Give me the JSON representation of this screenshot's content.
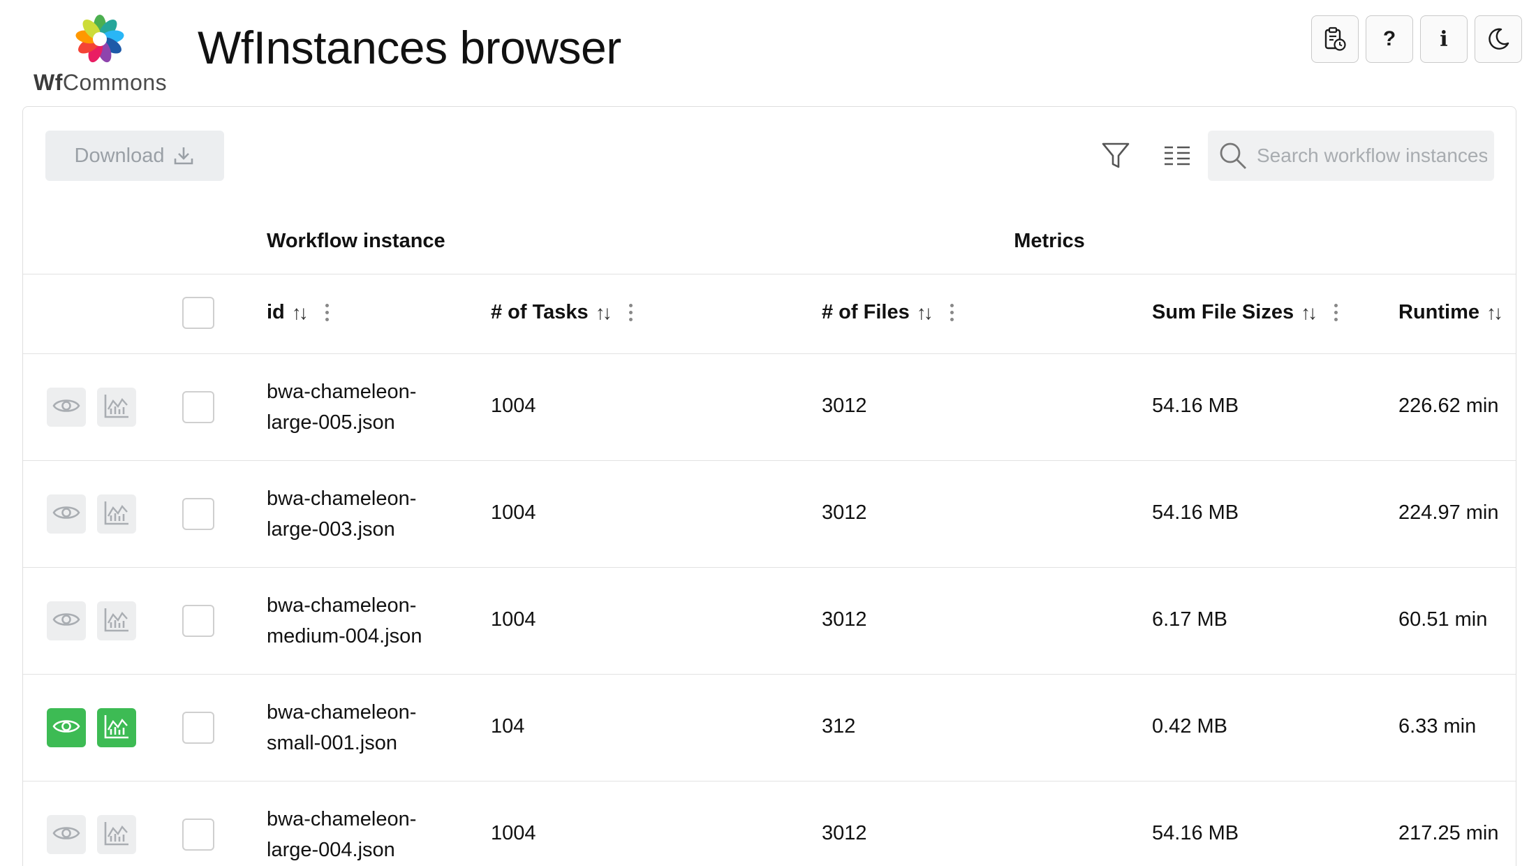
{
  "header": {
    "logo_text_bold": "Wf",
    "logo_text_rest": "Commons",
    "title": "WfInstances browser",
    "buttons": [
      {
        "name": "changelog",
        "icon": "clipboard-clock-icon"
      },
      {
        "name": "help",
        "label": "?"
      },
      {
        "name": "info",
        "label": "i"
      },
      {
        "name": "theme",
        "icon": "moon-icon"
      }
    ]
  },
  "toolbar": {
    "download_label": "Download",
    "search_placeholder": "Search workflow instances"
  },
  "groups": {
    "workflow_instance": "Workflow instance",
    "metrics": "Metrics"
  },
  "columns": {
    "id": "id",
    "tasks": "# of Tasks",
    "files": "# of Files",
    "sum_sizes": "Sum File Sizes",
    "runtime": "Runtime"
  },
  "rows": [
    {
      "id": "bwa-chameleon-large-005.json",
      "id_line1": "bwa-chameleon-",
      "id_line2": "large-005.json",
      "tasks": "1004",
      "files": "3012",
      "size": "54.16 MB",
      "runtime": "226.62 min",
      "active": false
    },
    {
      "id": "bwa-chameleon-large-003.json",
      "id_line1": "bwa-chameleon-",
      "id_line2": "large-003.json",
      "tasks": "1004",
      "files": "3012",
      "size": "54.16 MB",
      "runtime": "224.97 min",
      "active": false
    },
    {
      "id": "bwa-chameleon-medium-004.json",
      "id_line1": "bwa-chameleon-",
      "id_line2": "medium-004.json",
      "tasks": "1004",
      "files": "3012",
      "size": "6.17 MB",
      "runtime": "60.51 min",
      "active": false
    },
    {
      "id": "bwa-chameleon-small-001.json",
      "id_line1": "bwa-chameleon-",
      "id_line2": "small-001.json",
      "tasks": "104",
      "files": "312",
      "size": "0.42 MB",
      "runtime": "6.33 min",
      "active": true
    },
    {
      "id": "bwa-chameleon-large-004.json",
      "id_line1": "bwa-chameleon-",
      "id_line2": "large-004.json",
      "tasks": "1004",
      "files": "3012",
      "size": "54.16 MB",
      "runtime": "217.25 min",
      "active": false
    }
  ],
  "colors": {
    "active_green": "#3dbb54",
    "inactive_gray": "#edeeef"
  }
}
